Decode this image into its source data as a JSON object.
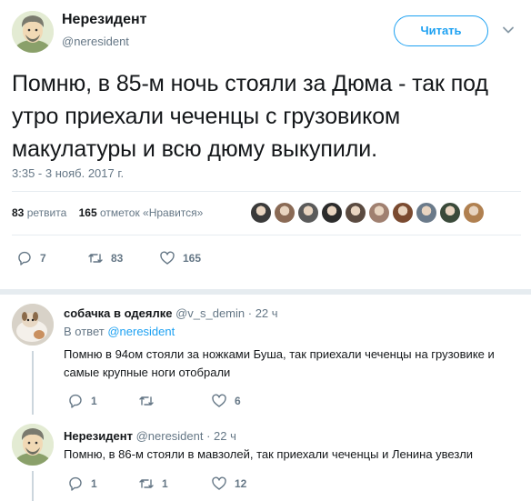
{
  "tweet": {
    "author_name": "Нерезидент",
    "author_handle": "@neresident",
    "follow_label": "Читать",
    "text": "Помню, в 85-м ночь стояли за Дюма - так под утро приехали чеченцы с грузовиком макулатуры и всю дюму выкупили.",
    "timestamp": "3:35 - 3 нояб. 2017 г.",
    "retweets_count": "83",
    "retweets_label": "ретвита",
    "likes_count": "165",
    "likes_label": "отметок «Нравится»",
    "actions": {
      "replies": "7",
      "retweets": "83",
      "likes": "165"
    }
  },
  "replies": [
    {
      "author_name": "собачка в одеялке",
      "author_handle": "@v_s_demin",
      "time": "· 22 ч",
      "reply_to_prefix": "В ответ",
      "reply_to_handle": "@neresident",
      "text": "Помню в 94ом стояли за ножками Буша, так приехали чеченцы на грузовике и самые крупные ноги отобрали",
      "actions": {
        "replies": "1",
        "retweets": "",
        "likes": "6"
      }
    },
    {
      "author_name": "Нерезидент",
      "author_handle": "@neresident",
      "time": "· 22 ч",
      "text": "Помню, в 86-м стояли в мавзолей, так приехали чеченцы и Ленина увезли",
      "actions": {
        "replies": "1",
        "retweets": "1",
        "likes": "12"
      }
    }
  ],
  "colors": {
    "accent": "#1da1f2",
    "secondary_text": "#657786",
    "like_avatars": [
      "#3a3a3a",
      "#8a6a55",
      "#5a5a5a",
      "#2b2b2b",
      "#5a4a40",
      "#a08070",
      "#7a4a30",
      "#6a7a8a",
      "#3a4a3a",
      "#b08050"
    ]
  }
}
